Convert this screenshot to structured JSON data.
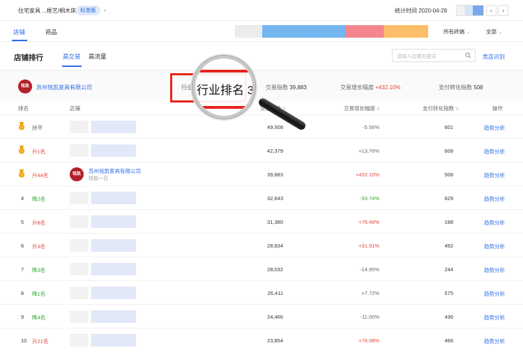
{
  "header": {
    "breadcrumb": "住宅家具 ...框艺/桐木床",
    "edition_badge": "标准版",
    "stat_time": "统计时间 2020-04-28"
  },
  "tabs": [
    "店铺",
    "商品"
  ],
  "filters": {
    "industry": "所有终端",
    "scope": "全部"
  },
  "ranking": {
    "title": "店铺排行",
    "subtabs": [
      "高交易",
      "高流量"
    ],
    "search_placeholder": "请输入店铺关键词",
    "compete_button": "竞店识别"
  },
  "my_shop": {
    "name": "苏州铭凯家具有限公司",
    "logo_text": "铭凯",
    "rank_label": "行业",
    "trade_label": "交易指数",
    "trade_value": "39,883",
    "growth_label": "交易增长幅度",
    "growth_value": "+432.10%",
    "conv_label": "支付转化指数",
    "conv_value": "508"
  },
  "columns": {
    "rank": "排名",
    "shop": "店铺",
    "trade": "交易指数",
    "growth": "交易增长幅度",
    "conv": "支付转化指数",
    "op": "操作"
  },
  "rows": [
    {
      "rank": "1",
      "change": "持平",
      "trade": "49,508",
      "growth": "-5.56%",
      "conv": "601",
      "op": "趋势分析",
      "medal": true,
      "dir": "flat",
      "growth_dir": "flat"
    },
    {
      "rank": "2",
      "change": "升1名",
      "trade": "42,379",
      "growth": "+13.76%",
      "conv": "608",
      "op": "趋势分析",
      "medal": true,
      "dir": "up",
      "growth_dir": "flat"
    },
    {
      "rank": "3",
      "change": "升44名",
      "trade": "39,883",
      "growth": "+432.10%",
      "conv": "508",
      "op": "趋势分析",
      "medal": true,
      "dir": "up",
      "growth_dir": "up",
      "shop_name": "苏州铭凯家具有限公司",
      "shop_sub": "较前一日"
    },
    {
      "rank": "4",
      "change": "降2名",
      "trade": "32,643",
      "growth": "-33.74%",
      "conv": "629",
      "op": "趋势分析",
      "dir": "down",
      "growth_dir": "down"
    },
    {
      "rank": "5",
      "change": "升8名",
      "trade": "31,380",
      "growth": "+76.48%",
      "conv": "188",
      "op": "趋势分析",
      "dir": "up",
      "growth_dir": "up"
    },
    {
      "rank": "6",
      "change": "升3名",
      "trade": "28,834",
      "growth": "+31.91%",
      "conv": "492",
      "op": "趋势分析",
      "dir": "up",
      "growth_dir": "up"
    },
    {
      "rank": "7",
      "change": "降3名",
      "trade": "28,032",
      "growth": "-14.95%",
      "conv": "244",
      "op": "趋势分析",
      "dir": "down",
      "growth_dir": "flat"
    },
    {
      "rank": "8",
      "change": "降1名",
      "trade": "26,411",
      "growth": "+7.72%",
      "conv": "575",
      "op": "趋势分析",
      "dir": "down",
      "growth_dir": "flat"
    },
    {
      "rank": "9",
      "change": "降4名",
      "trade": "24,466",
      "growth": "-11.00%",
      "conv": "436",
      "op": "趋势分析",
      "dir": "down",
      "growth_dir": "flat"
    },
    {
      "rank": "10",
      "change": "升21名",
      "trade": "23,854",
      "growth": "+76.08%",
      "conv": "466",
      "op": "趋势分析",
      "dir": "up",
      "growth_dir": "up"
    }
  ],
  "overlay": {
    "magnified_text": "行业排名 3"
  },
  "colors": {
    "accent": "#2e6be6",
    "up": "#e8453c",
    "down": "#29a329",
    "highlight": "#e8231b"
  }
}
